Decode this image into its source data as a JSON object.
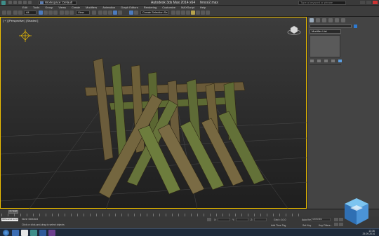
{
  "titlebar": {
    "workspace": "Workspace: Default",
    "title": "Autodesk 3ds Max  2014 x64",
    "filename": "fence2.max",
    "search_placeholder": "Type a keyword or phrase"
  },
  "menu": [
    "Edit",
    "Tools",
    "Group",
    "Views",
    "Create",
    "Modifiers",
    "Animation",
    "Graph Editors",
    "Rendering",
    "Customize",
    "MAXScript",
    "Help"
  ],
  "toolbar": {
    "selection_filter": "All",
    "reference_coord": "View",
    "named_selection": "Create Selection Se"
  },
  "viewport": {
    "label": "[ + ] [Perspective ] [Shaded ]"
  },
  "command_panel": {
    "modifier_list": "Modifier List"
  },
  "timeline": {
    "slider": "0 / 100"
  },
  "statusbar": {
    "maxscript": "Welcome to M",
    "status_line1": "None Selected",
    "status_line2": "Click or click-and-drag to select objects",
    "grid": "Grid = 10.0",
    "auto_key": "Auto Key",
    "set_key": "Set Key",
    "selected": "Selected",
    "key_filters": "Key Filters...",
    "add_time_tag": "Add Time Tag",
    "x_label": "X:",
    "y_label": "Y:",
    "z_label": "Z:"
  },
  "taskbar": {
    "time": "13:36",
    "date": "25.09.2014"
  },
  "colors": {
    "viewport_border": "#f2c200",
    "log_bark": "#5c4a30",
    "log_moss": "#6f7a3c",
    "accent": "#4c7bbd"
  }
}
